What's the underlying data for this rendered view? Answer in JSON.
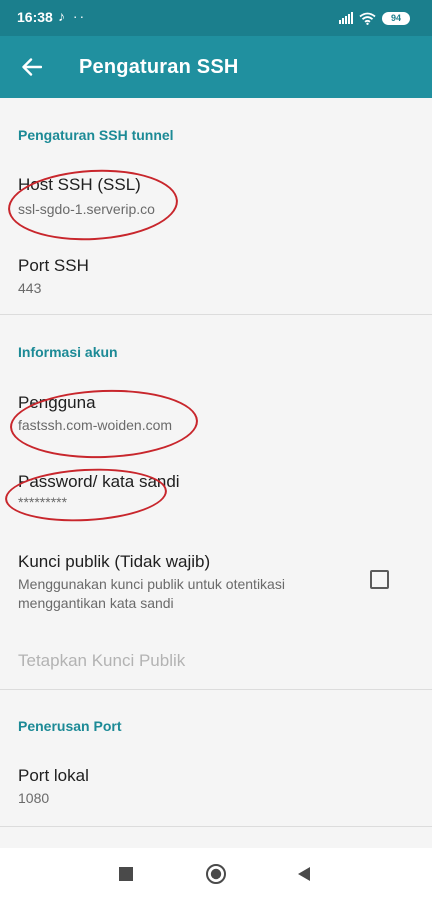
{
  "status_bar": {
    "time": "16:38",
    "left_icons": "♪ ··",
    "battery_level": "94"
  },
  "app_bar": {
    "title": "Pengaturan SSH"
  },
  "sections": {
    "ssh_tunnel": {
      "header": "Pengaturan SSH tunnel",
      "host": {
        "title": "Host SSH (SSL)",
        "value": "ssl-sgdo-1.serverip.co"
      },
      "port": {
        "title": "Port SSH",
        "value": "443"
      }
    },
    "account": {
      "header": "Informasi akun",
      "user": {
        "title": "Pengguna",
        "value": "fastssh.com-woiden.com"
      },
      "password": {
        "title": "Password/ kata sandi",
        "value": "*********"
      },
      "public_key": {
        "title": "Kunci publik (Tidak wajib)",
        "summary": "Menggunakan kunci publik untuk otentikasi menggantikan kata sandi",
        "checked": false
      },
      "set_public_key": {
        "title": "Tetapkan Kunci Publik"
      }
    },
    "port_forwarding": {
      "header": "Penerusan Port",
      "local_port": {
        "title": "Port lokal",
        "value": "1080"
      }
    }
  },
  "colors": {
    "status_bar": "#1b7f8d",
    "app_bar": "#20909f",
    "accent": "#1c8a96",
    "annotation": "#c8262c"
  },
  "icons": {
    "back": "arrow-left-icon",
    "wifi": "wifi-icon",
    "signal": "signal-icon",
    "battery": "battery-icon",
    "nav_recents": "square-icon",
    "nav_home": "circle-icon",
    "nav_back": "triangle-left-icon"
  }
}
